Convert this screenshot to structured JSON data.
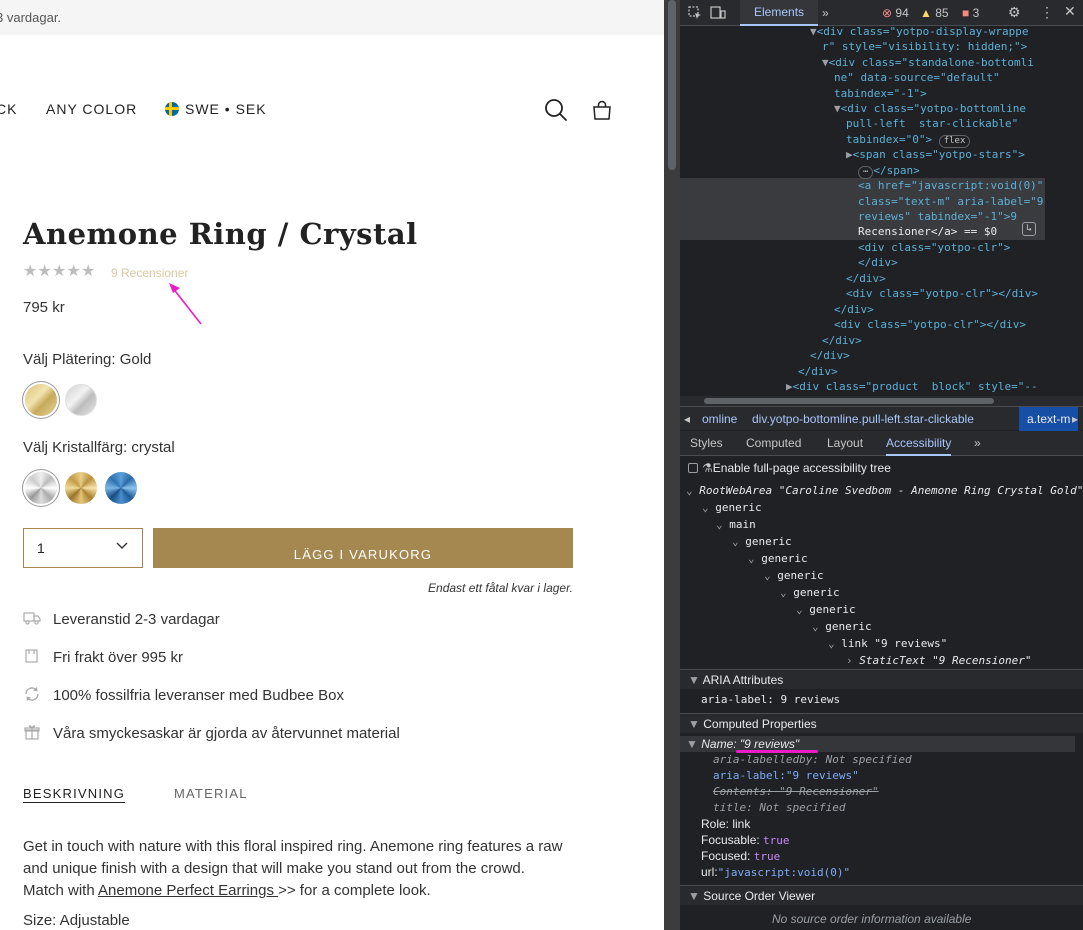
{
  "page": {
    "announcement": "3 vardagar.",
    "nav": {
      "item_partial": "CK",
      "any_color": "ANY COLOR",
      "locale": "SWE • SEK"
    },
    "product": {
      "title": "Anemone Ring / Crystal",
      "rating": {
        "stars": 5,
        "reviews_label": "9 Recensioner"
      },
      "price": "795 kr",
      "plating_label": "Välj Plätering: Gold",
      "crystal_label": "Välj Kristallfärg: crystal",
      "quantity": "1",
      "add_to_cart": "LÄGG I VARUKORG",
      "stock_note": "Endast ett fåtal kvar i lager.",
      "usps": [
        "Leveranstid 2-3 vardagar",
        "Fri frakt över 995 kr",
        "100% fossilfria leveranser med Budbee Box",
        "Våra smyckesaskar är gjorda av återvunnet material"
      ],
      "tabs": [
        "BESKRIVNING",
        "MATERIAL"
      ],
      "description_part1": "Get in touch with nature with this floral inspired ring. Anemone ring features a raw and unique finish with a design that will make you stand out from the crowd. Match with ",
      "description_link": "Anemone Perfect Earrings ",
      "description_part2": ">> for a complete look.",
      "size": "Size: Adjustable"
    },
    "colors": {
      "gold": "#a58850",
      "review_link": "#d8c8a0",
      "annotation_arrow": "#e91ec8"
    }
  },
  "devtools": {
    "tabs": {
      "elements": "Elements",
      "more": "»"
    },
    "badges": {
      "errors": "94",
      "warnings": "85",
      "info": "3"
    },
    "dom": {
      "l1a": "<div class=\"yotpo-display-wrappe",
      "l1b": "r\" style=\"visibility: hidden;\">",
      "l2a": "<div class=\"standalone-bottomli",
      "l2b": "ne\" data-source=\"default\"",
      "l2c": "tabindex=\"-1\">",
      "l3a": "<div class=\"yotpo-bottomline",
      "l3b": "pull-left  star-clickable\"",
      "l3c": "tabindex=\"0\">",
      "l3flex": "flex",
      "l4a": "<span class=\"yotpo-stars\">",
      "l4b": "</span>",
      "l5a": "<a href=\"javascript:void(0)\"",
      "l5b": "class=\"text-m\" aria-label=\"9",
      "l5c": "reviews\" tabindex=\"-1\">9",
      "l5d": "Recensioner</a> == $0",
      "l6": "<div class=\"yotpo-clr\">",
      "l7": "</div>",
      "l8": "</div>",
      "l9": "<div class=\"yotpo-clr\"></div>",
      "l10": "</div>",
      "l11": "<div class=\"yotpo-clr\"></div>",
      "l12": "</div>",
      "l13": "</div>",
      "l14": "</div>",
      "l15": "<div class=\"product  block\" style=\"--"
    },
    "breadcrumbs": [
      "omline",
      "div.yotpo-bottomline.pull-left.star-clickable",
      "a.text-m"
    ],
    "subtabs": [
      "Styles",
      "Computed",
      "Layout",
      "Accessibility",
      "»"
    ],
    "accessibility": {
      "full_tree": "Enable full-page accessibility tree",
      "root": "RootWebArea \"Caroline Svedbom - Anemone Ring Crystal Gold\"",
      "generic": "generic",
      "main": "main",
      "link": "link \"9 reviews\"",
      "static_text": "StaticText \"9 Recensioner\"",
      "aria_header": "ARIA Attributes",
      "aria_label_row": "aria-label: 9 reviews",
      "computed_header": "Computed Properties",
      "name_row": "Name: \"9 reviews\"",
      "labelledby": "aria-labelledby: Not specified",
      "label_key": "aria-label:",
      "label_val": "\"9 reviews\"",
      "contents": "Contents: \"9 Recensioner\"",
      "title_row": "title: Not specified",
      "role": "Role: link",
      "focusable_key": "Focusable:",
      "focusable_val": "true",
      "focused_key": "Focused:",
      "focused_val": "true",
      "url_key": "url:",
      "url_val": "\"javascript:void(0)\"",
      "source_header": "Source Order Viewer",
      "source_note": "No source order information available"
    }
  }
}
